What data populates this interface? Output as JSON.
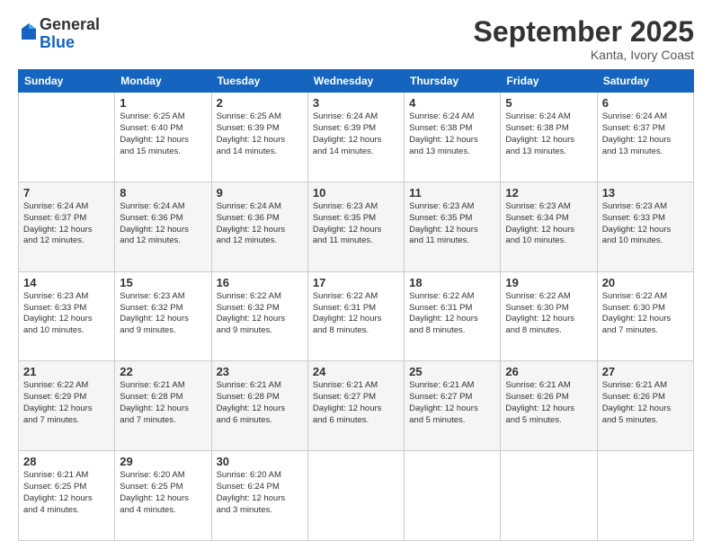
{
  "header": {
    "logo_general": "General",
    "logo_blue": "Blue",
    "month": "September 2025",
    "location": "Kanta, Ivory Coast"
  },
  "weekdays": [
    "Sunday",
    "Monday",
    "Tuesday",
    "Wednesday",
    "Thursday",
    "Friday",
    "Saturday"
  ],
  "weeks": [
    [
      {
        "day": "",
        "info": ""
      },
      {
        "day": "1",
        "info": "Sunrise: 6:25 AM\nSunset: 6:40 PM\nDaylight: 12 hours\nand 15 minutes."
      },
      {
        "day": "2",
        "info": "Sunrise: 6:25 AM\nSunset: 6:39 PM\nDaylight: 12 hours\nand 14 minutes."
      },
      {
        "day": "3",
        "info": "Sunrise: 6:24 AM\nSunset: 6:39 PM\nDaylight: 12 hours\nand 14 minutes."
      },
      {
        "day": "4",
        "info": "Sunrise: 6:24 AM\nSunset: 6:38 PM\nDaylight: 12 hours\nand 13 minutes."
      },
      {
        "day": "5",
        "info": "Sunrise: 6:24 AM\nSunset: 6:38 PM\nDaylight: 12 hours\nand 13 minutes."
      },
      {
        "day": "6",
        "info": "Sunrise: 6:24 AM\nSunset: 6:37 PM\nDaylight: 12 hours\nand 13 minutes."
      }
    ],
    [
      {
        "day": "7",
        "info": "Sunrise: 6:24 AM\nSunset: 6:37 PM\nDaylight: 12 hours\nand 12 minutes."
      },
      {
        "day": "8",
        "info": "Sunrise: 6:24 AM\nSunset: 6:36 PM\nDaylight: 12 hours\nand 12 minutes."
      },
      {
        "day": "9",
        "info": "Sunrise: 6:24 AM\nSunset: 6:36 PM\nDaylight: 12 hours\nand 12 minutes."
      },
      {
        "day": "10",
        "info": "Sunrise: 6:23 AM\nSunset: 6:35 PM\nDaylight: 12 hours\nand 11 minutes."
      },
      {
        "day": "11",
        "info": "Sunrise: 6:23 AM\nSunset: 6:35 PM\nDaylight: 12 hours\nand 11 minutes."
      },
      {
        "day": "12",
        "info": "Sunrise: 6:23 AM\nSunset: 6:34 PM\nDaylight: 12 hours\nand 10 minutes."
      },
      {
        "day": "13",
        "info": "Sunrise: 6:23 AM\nSunset: 6:33 PM\nDaylight: 12 hours\nand 10 minutes."
      }
    ],
    [
      {
        "day": "14",
        "info": "Sunrise: 6:23 AM\nSunset: 6:33 PM\nDaylight: 12 hours\nand 10 minutes."
      },
      {
        "day": "15",
        "info": "Sunrise: 6:23 AM\nSunset: 6:32 PM\nDaylight: 12 hours\nand 9 minutes."
      },
      {
        "day": "16",
        "info": "Sunrise: 6:22 AM\nSunset: 6:32 PM\nDaylight: 12 hours\nand 9 minutes."
      },
      {
        "day": "17",
        "info": "Sunrise: 6:22 AM\nSunset: 6:31 PM\nDaylight: 12 hours\nand 8 minutes."
      },
      {
        "day": "18",
        "info": "Sunrise: 6:22 AM\nSunset: 6:31 PM\nDaylight: 12 hours\nand 8 minutes."
      },
      {
        "day": "19",
        "info": "Sunrise: 6:22 AM\nSunset: 6:30 PM\nDaylight: 12 hours\nand 8 minutes."
      },
      {
        "day": "20",
        "info": "Sunrise: 6:22 AM\nSunset: 6:30 PM\nDaylight: 12 hours\nand 7 minutes."
      }
    ],
    [
      {
        "day": "21",
        "info": "Sunrise: 6:22 AM\nSunset: 6:29 PM\nDaylight: 12 hours\nand 7 minutes."
      },
      {
        "day": "22",
        "info": "Sunrise: 6:21 AM\nSunset: 6:28 PM\nDaylight: 12 hours\nand 7 minutes."
      },
      {
        "day": "23",
        "info": "Sunrise: 6:21 AM\nSunset: 6:28 PM\nDaylight: 12 hours\nand 6 minutes."
      },
      {
        "day": "24",
        "info": "Sunrise: 6:21 AM\nSunset: 6:27 PM\nDaylight: 12 hours\nand 6 minutes."
      },
      {
        "day": "25",
        "info": "Sunrise: 6:21 AM\nSunset: 6:27 PM\nDaylight: 12 hours\nand 5 minutes."
      },
      {
        "day": "26",
        "info": "Sunrise: 6:21 AM\nSunset: 6:26 PM\nDaylight: 12 hours\nand 5 minutes."
      },
      {
        "day": "27",
        "info": "Sunrise: 6:21 AM\nSunset: 6:26 PM\nDaylight: 12 hours\nand 5 minutes."
      }
    ],
    [
      {
        "day": "28",
        "info": "Sunrise: 6:21 AM\nSunset: 6:25 PM\nDaylight: 12 hours\nand 4 minutes."
      },
      {
        "day": "29",
        "info": "Sunrise: 6:20 AM\nSunset: 6:25 PM\nDaylight: 12 hours\nand 4 minutes."
      },
      {
        "day": "30",
        "info": "Sunrise: 6:20 AM\nSunset: 6:24 PM\nDaylight: 12 hours\nand 3 minutes."
      },
      {
        "day": "",
        "info": ""
      },
      {
        "day": "",
        "info": ""
      },
      {
        "day": "",
        "info": ""
      },
      {
        "day": "",
        "info": ""
      }
    ]
  ]
}
